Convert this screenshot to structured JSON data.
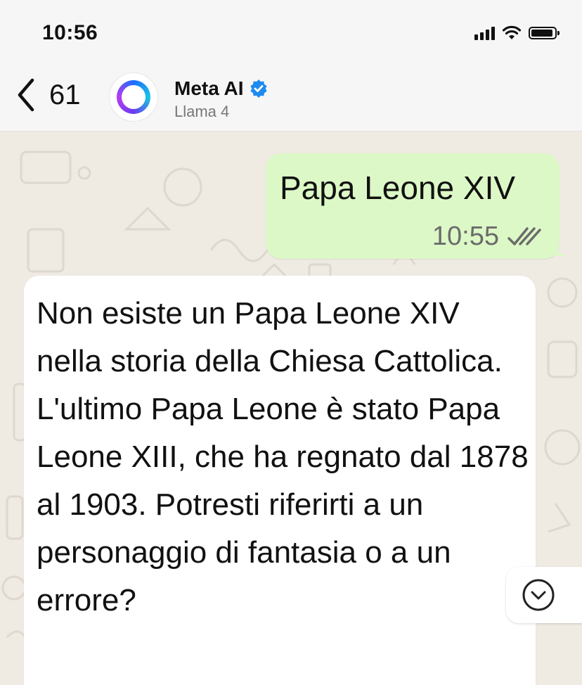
{
  "status_bar": {
    "time": "10:56"
  },
  "header": {
    "back_count": "61",
    "contact_name": "Meta AI",
    "contact_subtitle": "Llama 4",
    "icons": [
      "back-chevron-icon",
      "meta-ai-ring-icon",
      "verified-badge-icon"
    ]
  },
  "messages": [
    {
      "direction": "outgoing",
      "text": "Papa Leone XIV",
      "time": "10:55",
      "status": "read"
    },
    {
      "direction": "incoming",
      "text": "Non esiste un Papa Leone XIV nella storia della Chiesa Cattolica. L'ultimo Papa Leone è stato Papa Leone XIII, che ha regnato dal 1878 al 1903. Potresti riferirti a un personaggio di fantasia o a un errore?"
    }
  ],
  "colors": {
    "outgoing_bubble": "#dcf8c6",
    "incoming_bubble": "#ffffff",
    "chat_background": "#efeae2",
    "verified": "#1d8cf0",
    "read_ticks": "#6b6b6b"
  }
}
